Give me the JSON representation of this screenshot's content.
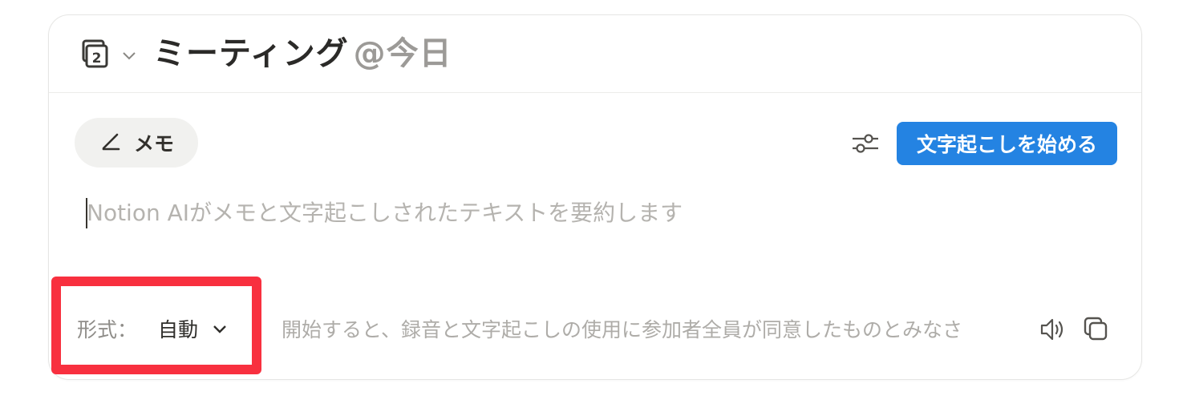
{
  "header": {
    "title": "ミーティング",
    "mention": "@今日",
    "page_icon": "calendar-page-icon",
    "chevron_icon": "chevron-down-icon"
  },
  "toolbar": {
    "memo_label": "メモ",
    "memo_icon": "pen-icon",
    "settings_icon": "sliders-icon",
    "start_label": "文字起こしを始める"
  },
  "summary": {
    "placeholder": "Notion AIがメモと文字起こしされたテキストを要約します"
  },
  "footer": {
    "format_label": "形式：",
    "format_value": "自動",
    "notice": "開始すると、録音と文字起こしの使用に参加者全員が同意したものとみなさ",
    "speaker_icon": "speaker-icon",
    "copy_icon": "copy-icon"
  },
  "colors": {
    "accent": "#2483e2",
    "highlight": "#f8303f",
    "title_text": "#2b2a28",
    "muted_text": "#9c9a97"
  }
}
